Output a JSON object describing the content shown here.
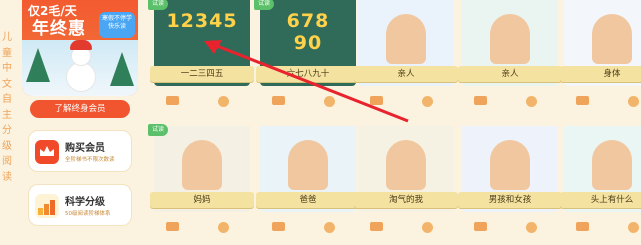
{
  "sidebar": {
    "vertical_text": [
      "儿",
      "童",
      "中",
      "文",
      "自",
      "主",
      "分",
      "级",
      "阅",
      "读"
    ],
    "promo": {
      "line1": "仅2毛/天",
      "line2": "年终惠",
      "badge": "寒假不停学 快乐读",
      "button": "了解终身会员"
    },
    "cards": [
      {
        "title": "购买会员",
        "subtitle": "全阶梯书不限次数读"
      },
      {
        "title": "科学分级",
        "subtitle": "50级阅读阶梯体系"
      }
    ]
  },
  "books": [
    {
      "title": "一二三四五",
      "tag": "试读",
      "cover_text": "12345",
      "color": "#2f6b58"
    },
    {
      "title": "六七八九十",
      "tag": "试读",
      "cover_text": "678 90",
      "color": "#2f6b58"
    },
    {
      "title": "亲人",
      "tag": "",
      "cover_text": "",
      "color": "#eaf3fb"
    },
    {
      "title": "亲人",
      "tag": "",
      "cover_text": "",
      "color": "#eaf5f2"
    },
    {
      "title": "身体",
      "tag": "",
      "cover_text": "",
      "color": "#f3f6fa"
    },
    {
      "title": "妈妈",
      "tag": "试读",
      "cover_text": "",
      "color": "#f5f0e4"
    },
    {
      "title": "爸爸",
      "tag": "",
      "cover_text": "",
      "color": "#eaf4f8"
    },
    {
      "title": "淘气的我",
      "tag": "",
      "cover_text": "",
      "color": "#f6f2e3"
    },
    {
      "title": "男孩和女孩",
      "tag": "",
      "cover_text": "",
      "color": "#eef3fb"
    },
    {
      "title": "头上有什么",
      "tag": "",
      "cover_text": "",
      "color": "#eaf6f4"
    }
  ],
  "colors": {
    "accent": "#f0552f",
    "arrow": "#e8232e",
    "ribbon": "#f3e2a0"
  }
}
